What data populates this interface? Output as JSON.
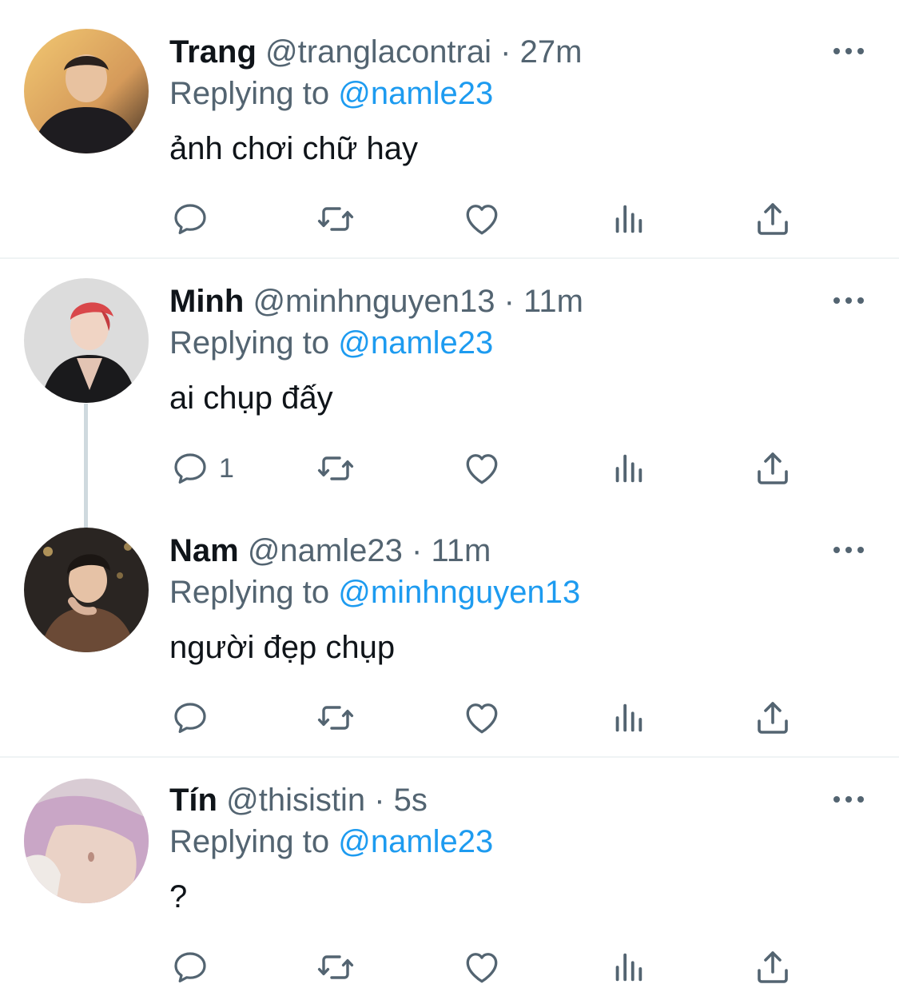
{
  "tweets": [
    {
      "name": "Trang",
      "handle": "@tranglacontrai",
      "separator": "·",
      "time": "27m",
      "reply_prefix": "Replying to",
      "reply_to": "@namle23",
      "text": "ảnh chơi chữ hay",
      "reply_count": ""
    },
    {
      "name": "Minh",
      "handle": "@minhnguyen13",
      "separator": "·",
      "time": "11m",
      "reply_prefix": "Replying to",
      "reply_to": "@namle23",
      "text": "ai chụp đấy",
      "reply_count": "1"
    },
    {
      "name": "Nam",
      "handle": "@namle23",
      "separator": "·",
      "time": "11m",
      "reply_prefix": "Replying to",
      "reply_to": "@minhnguyen13",
      "text": "người đẹp chụp",
      "reply_count": ""
    },
    {
      "name": "Tín",
      "handle": "@thisistin",
      "separator": "·",
      "time": "5s",
      "reply_prefix": "Replying to",
      "reply_to": "@namle23",
      "text": "?",
      "reply_count": ""
    }
  ],
  "icons": {
    "more": "more-horizontal-icon",
    "reply": "reply-bubble-icon",
    "retweet": "retweet-icon",
    "like": "heart-icon",
    "views": "views-bar-chart-icon",
    "share": "share-upload-icon"
  },
  "colors": {
    "name": "#0f1419",
    "secondary": "#536471",
    "mention": "#1d9bf0",
    "divider": "#eff3f4",
    "thread_line": "#cfd9de"
  }
}
